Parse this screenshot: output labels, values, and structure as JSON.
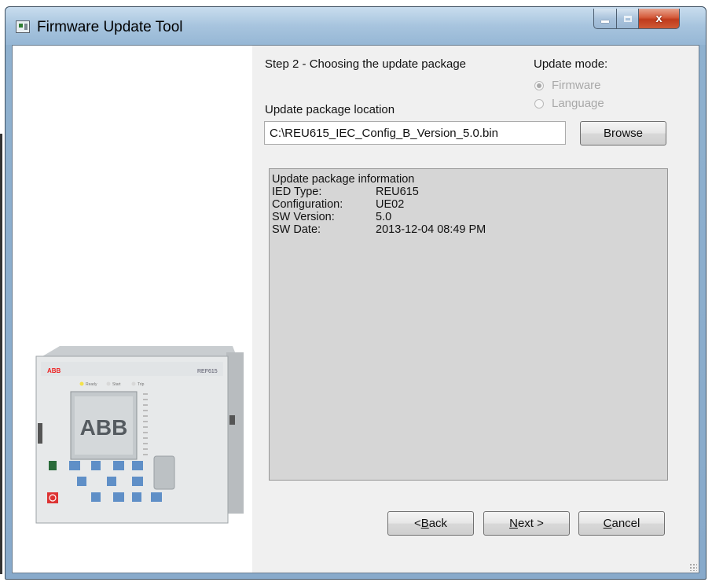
{
  "window": {
    "title": "Firmware Update Tool",
    "controls": {
      "minimize": "minimize",
      "maximize": "maximize",
      "close": "x"
    }
  },
  "device": {
    "brand": "ABB",
    "model": "REF615",
    "led_labels": [
      "Ready",
      "Start",
      "Trip"
    ]
  },
  "step": {
    "title": "Step 2 - Choosing the update package"
  },
  "update_mode": {
    "label": "Update mode:",
    "options": [
      {
        "label": "Firmware",
        "selected": true,
        "enabled": false
      },
      {
        "label": "Language",
        "selected": false,
        "enabled": false
      }
    ]
  },
  "package": {
    "location_label": "Update package location",
    "path": "C:\\REU615_IEC_Config_B_Version_5.0.bin",
    "browse_label": "Browse"
  },
  "info": {
    "heading": "Update package information",
    "rows": [
      {
        "key": "IED Type:",
        "value": "REU615"
      },
      {
        "key": "Configuration:",
        "value": "UE02"
      },
      {
        "key": "SW Version:",
        "value": "5.0"
      },
      {
        "key": "SW Date:",
        "value": "2013-12-04 08:49 PM"
      }
    ]
  },
  "nav": {
    "back_lt": "< ",
    "back_mnemonic": "B",
    "back_rest": "ack",
    "next_mnemonic": "N",
    "next_rest": "ext >",
    "cancel_mnemonic": "C",
    "cancel_rest": "ancel"
  },
  "colors": {
    "titlebar": "#a7c4de",
    "close_button": "#c03b1c",
    "panel": "#f0f0f0",
    "info_box": "#d6d6d6"
  }
}
